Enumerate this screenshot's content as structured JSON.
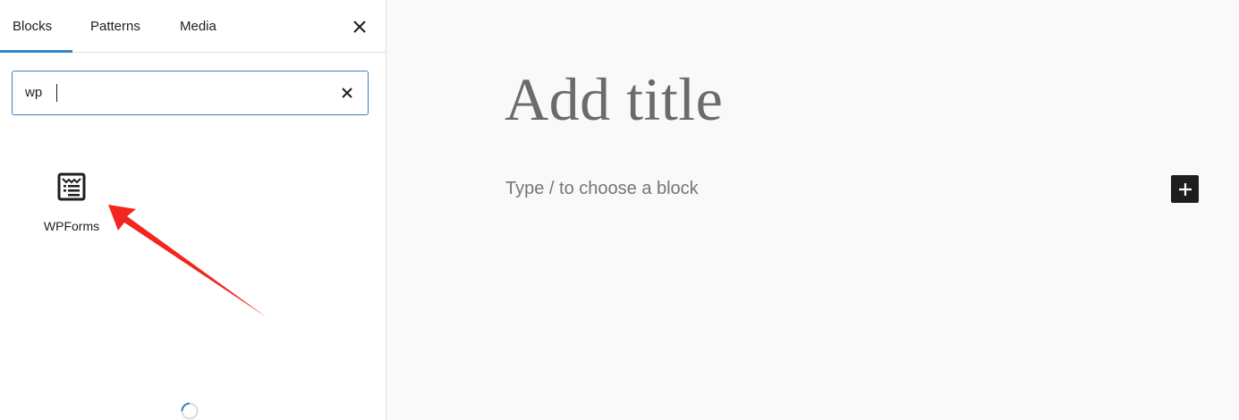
{
  "inserter": {
    "tabs": [
      {
        "label": "Blocks"
      },
      {
        "label": "Patterns"
      },
      {
        "label": "Media"
      }
    ],
    "search": {
      "value": "wp",
      "placeholder": ""
    },
    "results": [
      {
        "label": "WPForms",
        "icon": "wpforms-icon"
      }
    ]
  },
  "editor": {
    "title_placeholder": "Add title",
    "block_placeholder": "Type / to choose a block"
  },
  "colors": {
    "accent": "#3582c4",
    "annotation_arrow": "#f2261f",
    "text": "#1e1e1e"
  }
}
